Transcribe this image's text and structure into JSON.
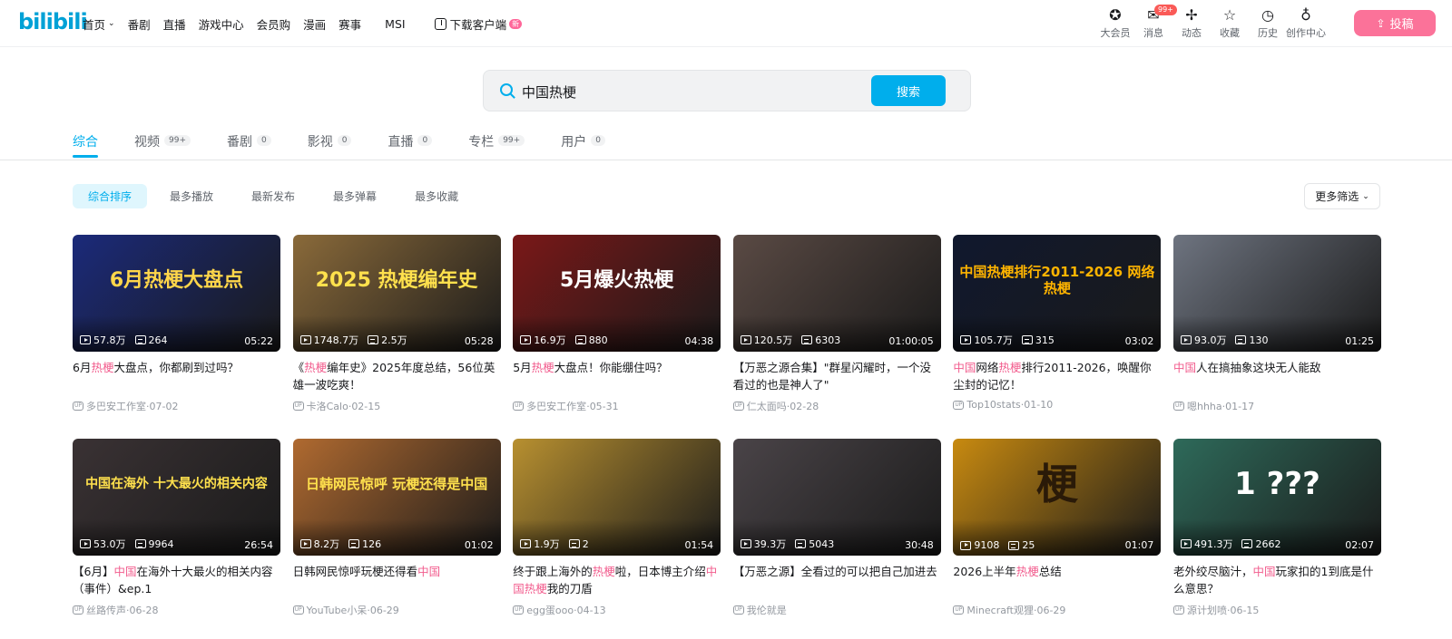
{
  "header": {
    "logo": "bilibili",
    "nav": [
      {
        "label": "首页",
        "dropdown": true
      },
      {
        "label": "番剧"
      },
      {
        "label": "直播"
      },
      {
        "label": "游戏中心"
      },
      {
        "label": "会员购"
      },
      {
        "label": "漫画"
      },
      {
        "label": "赛事"
      }
    ],
    "msi": "MSI",
    "download": {
      "label": "下载客户端",
      "badge": "新"
    },
    "right_nav": [
      {
        "label": "大会员",
        "icon": "vip-icon",
        "glyph": "✪"
      },
      {
        "label": "消息",
        "icon": "message-icon",
        "glyph": "✉",
        "badge": "99+"
      },
      {
        "label": "动态",
        "icon": "dynamic-icon",
        "glyph": "✢"
      },
      {
        "label": "收藏",
        "icon": "favorite-icon",
        "glyph": "☆"
      },
      {
        "label": "历史",
        "icon": "history-icon",
        "glyph": "◷"
      },
      {
        "label": "创作中心",
        "icon": "creator-icon",
        "glyph": "♁"
      }
    ],
    "upload": "投稿"
  },
  "search": {
    "value": "中国热梗",
    "button": "搜索"
  },
  "tabs": [
    {
      "label": "综合",
      "active": true
    },
    {
      "label": "视频",
      "count": "99+"
    },
    {
      "label": "番剧",
      "count": "0"
    },
    {
      "label": "影视",
      "count": "0"
    },
    {
      "label": "直播",
      "count": "0"
    },
    {
      "label": "专栏",
      "count": "99+"
    },
    {
      "label": "用户",
      "count": "0"
    }
  ],
  "filters": [
    {
      "label": "综合排序",
      "active": true
    },
    {
      "label": "最多播放"
    },
    {
      "label": "最新发布"
    },
    {
      "label": "最多弹幕"
    },
    {
      "label": "最多收藏"
    }
  ],
  "more_filter": "更多筛选",
  "videos": [
    {
      "thumb_text": "6月热梗大盘点",
      "bg": "#1b2a7a",
      "fg": "#ffd64a",
      "size": 22,
      "plays": "57.8万",
      "danmaku": "264",
      "duration": "05:22",
      "title": [
        [
          "6月",
          ""
        ],
        [
          "热梗",
          "hl"
        ],
        [
          "大盘点，你都刷到过吗？",
          ""
        ]
      ],
      "uploader": "多巴安工作室",
      "date": "07-02"
    },
    {
      "thumb_text": "2025 热梗编年史",
      "bg": "#8a6a3a",
      "fg": "#ffe14d",
      "size": 22,
      "plays": "1748.7万",
      "danmaku": "2.5万",
      "duration": "05:28",
      "title": [
        [
          "《",
          ""
        ],
        [
          "热梗",
          "hl"
        ],
        [
          "编年史》2025年度总结，56位英雄一波吃爽！",
          ""
        ]
      ],
      "uploader": "卡洛Calo",
      "date": "02-15"
    },
    {
      "thumb_text": "5月爆火热梗",
      "bg": "#7a1818",
      "fg": "#ffffff",
      "size": 22,
      "plays": "16.9万",
      "danmaku": "880",
      "duration": "04:38",
      "title": [
        [
          "5月",
          ""
        ],
        [
          "热梗",
          "hl"
        ],
        [
          "大盘点！你能绷住吗？",
          ""
        ]
      ],
      "uploader": "多巴安工作室",
      "date": "05-31"
    },
    {
      "thumb_text": "",
      "bg": "#5a4a44",
      "fg": "#ffffff",
      "size": 14,
      "plays": "120.5万",
      "danmaku": "6303",
      "duration": "01:00:05",
      "title": [
        [
          "【万恶之源合集】\"群星闪耀时，一个没看过的也是神人了\"",
          ""
        ]
      ],
      "uploader": "仁太面吗",
      "date": "02-28"
    },
    {
      "thumb_text": "中国热梗排行2011-2026 网络热梗",
      "bg": "#10182e",
      "fg": "#ffb400",
      "size": 15,
      "plays": "105.7万",
      "danmaku": "315",
      "duration": "03:02",
      "title": [
        [
          "中国",
          "hl"
        ],
        [
          "网络",
          ""
        ],
        [
          "热梗",
          "hl"
        ],
        [
          "排行2011-2026，唤醒你尘封的记忆！",
          ""
        ]
      ],
      "uploader": "Top10stats",
      "date": "01-10"
    },
    {
      "thumb_text": "",
      "bg": "#6e7480",
      "fg": "#ffffff",
      "size": 12,
      "plays": "93.0万",
      "danmaku": "130",
      "duration": "01:25",
      "title": [
        [
          "中国",
          "hl"
        ],
        [
          "人在搞抽象这块无人能敌",
          ""
        ]
      ],
      "uploader": "嗯hhha",
      "date": "01-17"
    },
    {
      "thumb_text": "中国在海外 十大最火的相关内容",
      "bg": "#3a3234",
      "fg": "#ffe14d",
      "size": 14,
      "plays": "53.0万",
      "danmaku": "9964",
      "duration": "26:54",
      "title": [
        [
          "【6月】",
          ""
        ],
        [
          "中国",
          "hl"
        ],
        [
          "在海外十大最火的相关内容（事件）&ep.1",
          ""
        ]
      ],
      "uploader": "丝路传声",
      "date": "06-28"
    },
    {
      "thumb_text": "日韩网民惊呼 玩梗还得是中国",
      "bg": "#b06a30",
      "fg": "#ffe14d",
      "size": 15,
      "plays": "8.2万",
      "danmaku": "126",
      "duration": "01:02",
      "title": [
        [
          "日韩网民惊呼玩梗还得看",
          ""
        ],
        [
          "中国",
          "hl"
        ]
      ],
      "uploader": "YouTube小呆",
      "date": "06-29"
    },
    {
      "thumb_text": "",
      "bg": "#b89030",
      "fg": "#ffffff",
      "size": 12,
      "plays": "1.9万",
      "danmaku": "2",
      "duration": "01:54",
      "title": [
        [
          "终于跟上海外的",
          ""
        ],
        [
          "热梗",
          "hl"
        ],
        [
          "啦，日本博主介绍",
          ""
        ],
        [
          "中国热梗",
          "hl"
        ],
        [
          "我的刀盾",
          ""
        ]
      ],
      "uploader": "egg蛋ooo",
      "date": "04-13"
    },
    {
      "thumb_text": "",
      "bg": "#4a4448",
      "fg": "#ffffff",
      "size": 12,
      "plays": "39.3万",
      "danmaku": "5043",
      "duration": "30:48",
      "title": [
        [
          "【万恶之源】全看过的可以把自己加进去",
          ""
        ]
      ],
      "uploader": "我伦就是",
      "date": ""
    },
    {
      "thumb_text": "梗",
      "bg": "#c88a10",
      "fg": "#2a1a08",
      "size": 46,
      "plays": "9108",
      "danmaku": "25",
      "duration": "01:07",
      "title": [
        [
          "2026上半年",
          ""
        ],
        [
          "热梗",
          "hl"
        ],
        [
          "总结",
          ""
        ]
      ],
      "uploader": "Minecraft观狸",
      "date": "06-29"
    },
    {
      "thumb_text": "1 ???",
      "bg": "#2e6a5a",
      "fg": "#ffffff",
      "size": 34,
      "plays": "491.3万",
      "danmaku": "2662",
      "duration": "02:07",
      "title": [
        [
          "老外绞尽脑汁，",
          ""
        ],
        [
          "中国",
          "hl"
        ],
        [
          "玩家扣的1到底是什么意思？",
          ""
        ]
      ],
      "uploader": "源计划喷",
      "date": "06-15"
    }
  ]
}
